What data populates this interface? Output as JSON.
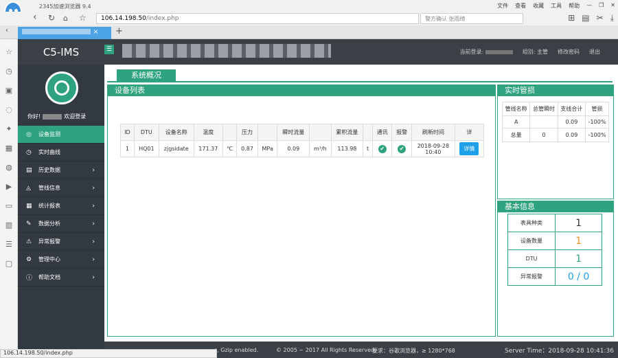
{
  "browser": {
    "title": "2345加速浏览器 9.4",
    "menu": [
      "文件",
      "查看",
      "收藏",
      "工具",
      "帮助"
    ],
    "url_host": "106.14.198.50",
    "url_path": "/index.php",
    "search_placeholder": "警方确认 张雨绮",
    "status_url": "106.14.198.50/index.php"
  },
  "app": {
    "brand": "C5-IMS",
    "menu_toggle": "☰",
    "login_label": "当前登录:",
    "role": "组别: 主管",
    "change_pwd": "修改密码",
    "logout": "退出"
  },
  "sidebar": {
    "greet": "你好!",
    "welcome": "欢迎登录",
    "items": [
      {
        "label": "设备监测",
        "icon": "◎",
        "arrow": ""
      },
      {
        "label": "实时曲线",
        "icon": "◷",
        "arrow": ""
      },
      {
        "label": "历史数据",
        "icon": "▤",
        "arrow": "›"
      },
      {
        "label": "管线信息",
        "icon": "◬",
        "arrow": "›"
      },
      {
        "label": "统计报表",
        "icon": "▦",
        "arrow": "›"
      },
      {
        "label": "数据分析",
        "icon": "✎",
        "arrow": "›"
      },
      {
        "label": "异常报警",
        "icon": "⚠",
        "arrow": "›"
      },
      {
        "label": "管理中心",
        "icon": "⚙",
        "arrow": "›"
      },
      {
        "label": "帮助文档",
        "icon": "ⓘ",
        "arrow": "›"
      }
    ]
  },
  "page": {
    "tab": "系统概况",
    "device_panel": "设备列表",
    "realtime_panel": "实时管损",
    "basic_panel": "基本信息"
  },
  "device_table": {
    "headers": [
      "ID",
      "DTU",
      "设备名称",
      "温度",
      "",
      "压力",
      "",
      "瞬时流量",
      "",
      "累积流量",
      "",
      "通讯",
      "报警",
      "刷新时间",
      "详"
    ],
    "row": {
      "id": "1",
      "dtu": "HQ01",
      "name": "zjgsidate",
      "temp": "171.37",
      "temp_unit": "℃",
      "pressure": "0.87",
      "pressure_unit": "MPa",
      "flow": "0.09",
      "flow_unit": "m³/h",
      "total": "113.98",
      "total_unit": "t",
      "comm": "✔",
      "alarm": "✔",
      "time1": "2018-09-28",
      "time2": "10:40",
      "detail": "详情"
    }
  },
  "realtime_table": {
    "headers": [
      "管线名称",
      "总管瞬时",
      "支线合计",
      "管损"
    ],
    "rows": [
      [
        "A",
        "",
        "0.09",
        "-100%"
      ],
      [
        "总量",
        "0",
        "0.09",
        "-100%"
      ]
    ]
  },
  "basic_info": [
    {
      "label": "表具种类",
      "value": "1",
      "color": "#333333"
    },
    {
      "label": "设备数量",
      "value": "1",
      "color": "#f08c1e"
    },
    {
      "label": "DTU",
      "value": "1",
      "color": "#2fa37f"
    },
    {
      "label": "异常报警",
      "value": "0 / 0",
      "color": "#1ea0e8"
    }
  ],
  "footer": {
    "gzip": "s, Gzip enabled.",
    "copyright": "© 2005 ~ 2017 All Rights Reserved.",
    "require": "要求：谷歌浏览器，≥ 1280*768",
    "server_time": "Server Time：2018-09-28 10:41:36"
  }
}
